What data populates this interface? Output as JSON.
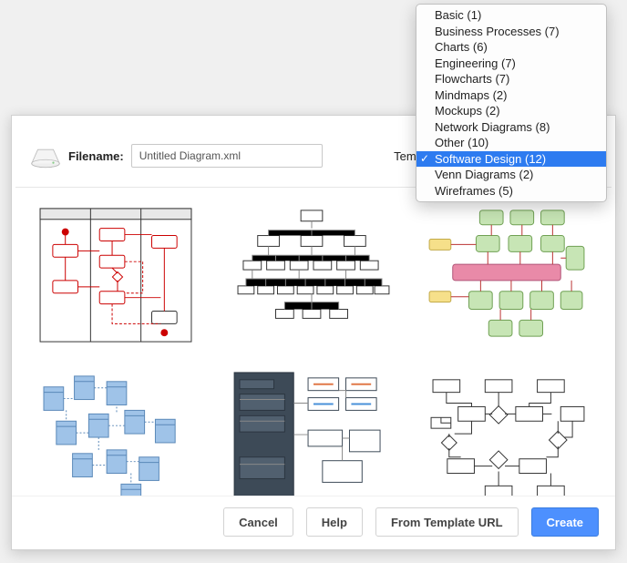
{
  "dialog": {
    "filename_label": "Filename:",
    "filename_value": "Untitled Diagram.xml",
    "templates_label": "Templates:"
  },
  "buttons": {
    "cancel": "Cancel",
    "help": "Help",
    "from_url": "From Template URL",
    "create": "Create"
  },
  "dropdown": {
    "items": [
      {
        "label": "Basic (1)",
        "selected": false
      },
      {
        "label": "Business Processes (7)",
        "selected": false
      },
      {
        "label": "Charts (6)",
        "selected": false
      },
      {
        "label": "Engineering (7)",
        "selected": false
      },
      {
        "label": "Flowcharts (7)",
        "selected": false
      },
      {
        "label": "Mindmaps (2)",
        "selected": false
      },
      {
        "label": "Mockups (2)",
        "selected": false
      },
      {
        "label": "Network Diagrams (8)",
        "selected": false
      },
      {
        "label": "Other (10)",
        "selected": false
      },
      {
        "label": "Software Design (12)",
        "selected": true
      },
      {
        "label": "Venn Diagrams (2)",
        "selected": false
      },
      {
        "label": "Wireframes (5)",
        "selected": false
      }
    ]
  },
  "thumbnails": [
    {
      "id": "activity-diagram"
    },
    {
      "id": "org-chart"
    },
    {
      "id": "enterprise-system"
    },
    {
      "id": "db-schema"
    },
    {
      "id": "dark-modules"
    },
    {
      "id": "er-diagram"
    }
  ]
}
